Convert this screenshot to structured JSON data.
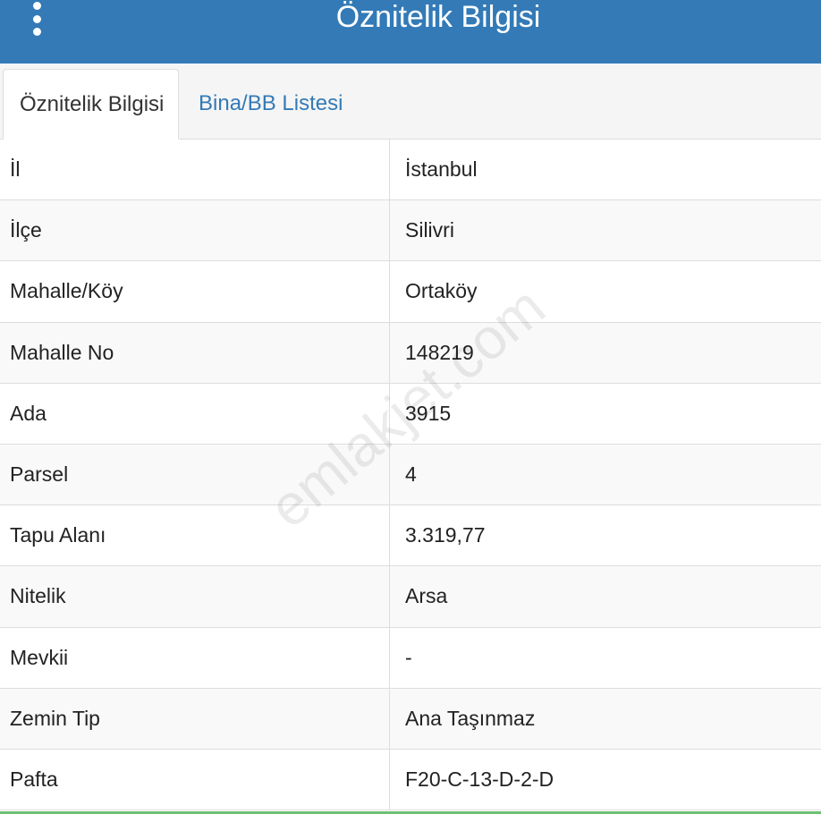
{
  "header": {
    "title": "Öznitelik Bilgisi",
    "menu_icon": "vertical-ellipsis-icon",
    "background": "#337ab7"
  },
  "tabs": [
    {
      "label": "Öznitelik Bilgisi",
      "active": true
    },
    {
      "label": "Bina/BB Listesi",
      "active": false
    }
  ],
  "rows": [
    {
      "label": "İl",
      "value": "İstanbul"
    },
    {
      "label": "İlçe",
      "value": "Silivri"
    },
    {
      "label": "Mahalle/Köy",
      "value": "Ortaköy"
    },
    {
      "label": "Mahalle No",
      "value": "148219"
    },
    {
      "label": "Ada",
      "value": "3915"
    },
    {
      "label": "Parsel",
      "value": "4"
    },
    {
      "label": "Tapu Alanı",
      "value": "3.319,77"
    },
    {
      "label": "Nitelik",
      "value": "Arsa"
    },
    {
      "label": "Mevkii",
      "value": "-"
    },
    {
      "label": "Zemin Tip",
      "value": "Ana Taşınmaz"
    },
    {
      "label": "Pafta",
      "value": "F20-C-13-D-2-D"
    }
  ],
  "watermark": "emlakjet.com"
}
